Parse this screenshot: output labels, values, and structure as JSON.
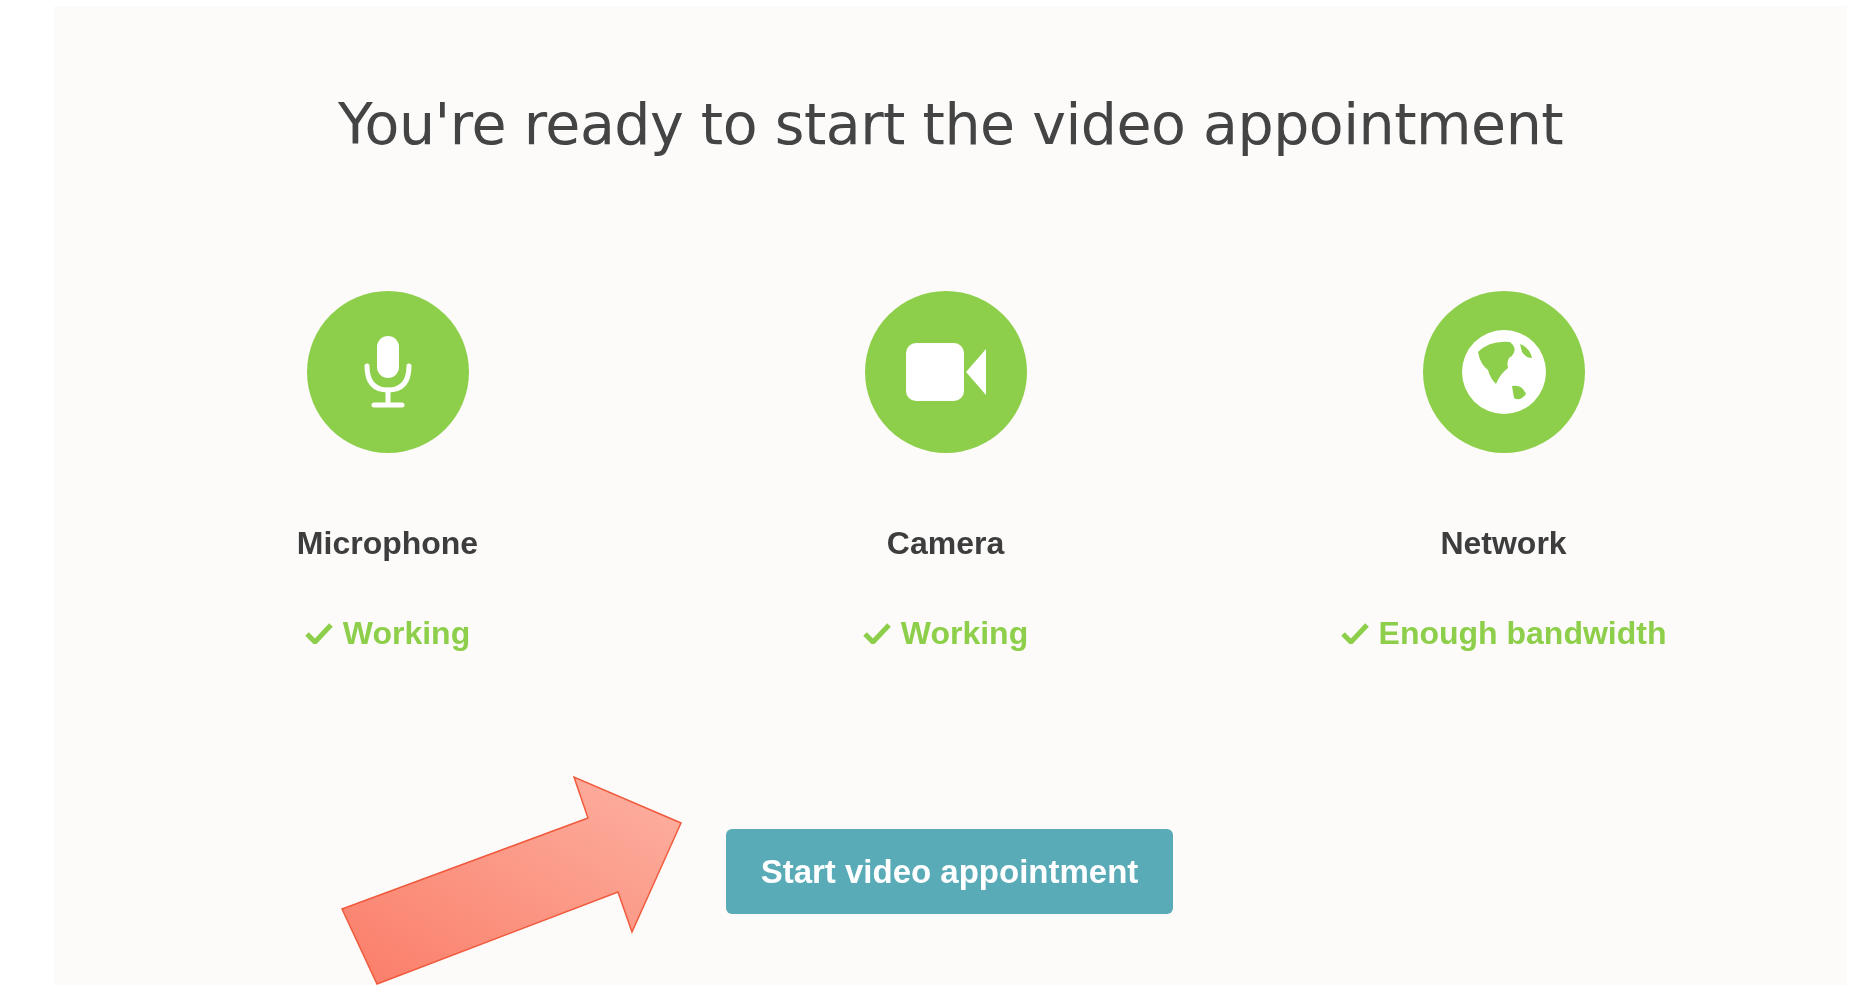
{
  "title": "You're ready to start the video appointment",
  "checks": [
    {
      "kind": "microphone",
      "label": "Microphone",
      "status": "Working",
      "ok": true
    },
    {
      "kind": "camera",
      "label": "Camera",
      "status": "Working",
      "ok": true
    },
    {
      "kind": "network",
      "label": "Network",
      "status": "Enough bandwidth",
      "ok": true
    }
  ],
  "start_button": "Start video appointment"
}
